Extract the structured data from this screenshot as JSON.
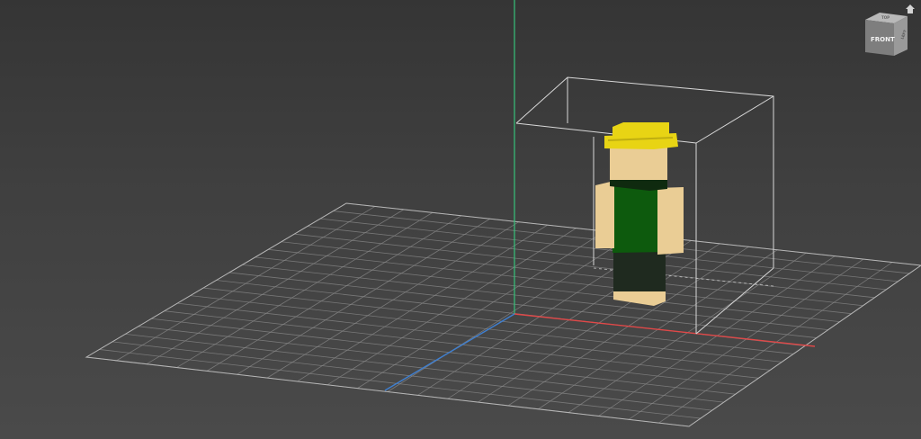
{
  "viewport": {
    "background_top": "#353535",
    "background_bottom": "#4a4a4a"
  },
  "axes": {
    "x_color": "#e04848",
    "y_color": "#3f7fd0",
    "z_color": "#36c27a"
  },
  "grid": {
    "line_color": "#8a8a8a",
    "divisions": 20
  },
  "selection_box": {
    "color": "#d8d8d8"
  },
  "character": {
    "hat_color": "#e8d414",
    "skin_color": "#eacd95",
    "shirt_color": "#0d5a0d",
    "pants_color": "#1f2a1f",
    "shoe_color": "#eacd95"
  },
  "viewcube": {
    "face_label": "FRONT",
    "top_label": "TOP",
    "side_label": "LEFT",
    "icon": "home-icon"
  }
}
